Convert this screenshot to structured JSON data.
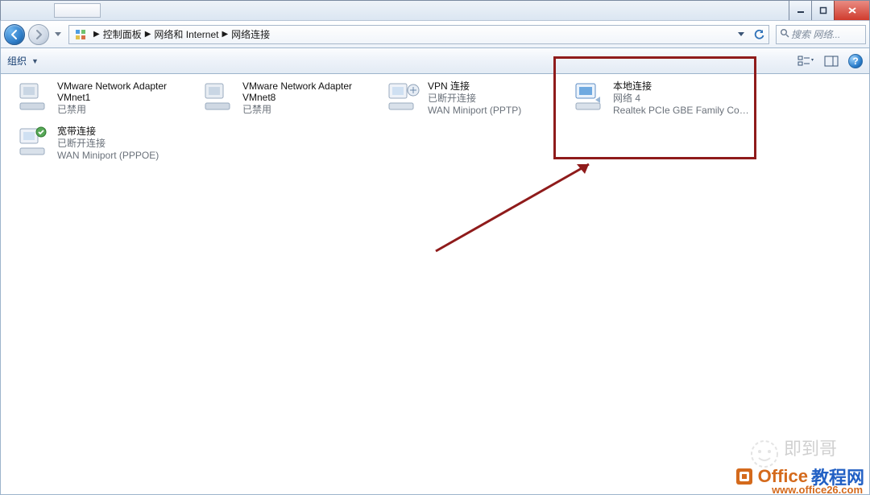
{
  "breadcrumb": {
    "item0": "控制面板",
    "item1": "网络和 Internet",
    "item2": "网络连接"
  },
  "search": {
    "placeholder": "搜索 网络..."
  },
  "commandbar": {
    "organize": "组织"
  },
  "items": {
    "a": {
      "name": "VMware Network Adapter VMnet1",
      "name_line1": "VMware Network Adapter",
      "name_line2": "VMnet1",
      "status": "已禁用",
      "device": ""
    },
    "b": {
      "name": "VMware Network Adapter VMnet8",
      "name_line1": "VMware Network Adapter",
      "name_line2": "VMnet8",
      "status": "已禁用",
      "device": ""
    },
    "c": {
      "name": "VPN 连接",
      "status": "已断开连接",
      "device": "WAN Miniport (PPTP)"
    },
    "d": {
      "name": "本地连接",
      "status": "网络 4",
      "device": "Realtek PCIe GBE Family Contr..."
    },
    "e": {
      "name": "宽带连接",
      "status": "已断开连接",
      "device": "WAN Miniport (PPPOE)"
    }
  },
  "watermark": {
    "name": "即到哥",
    "brand1": "Office",
    "brand2": "教程网",
    "url": "www.office26.com"
  }
}
